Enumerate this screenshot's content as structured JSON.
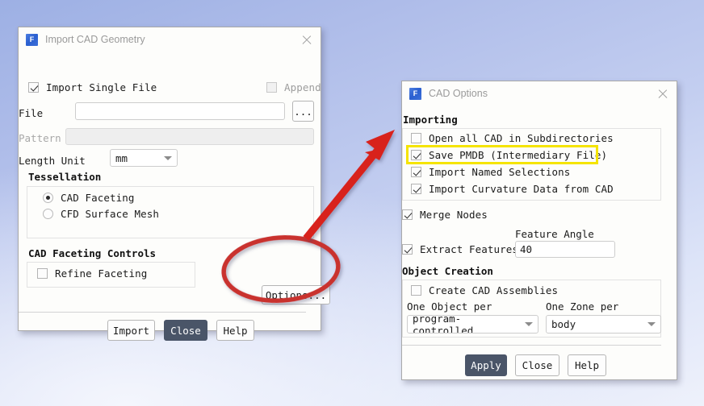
{
  "import_dialog": {
    "title": "Import CAD Geometry",
    "icon": "fluent-app-icon",
    "close_icon": "close-icon",
    "import_single_file": {
      "label": "Import Single File",
      "checked": true
    },
    "append": {
      "label": "Append",
      "checked": false,
      "enabled": false
    },
    "file": {
      "label": "File",
      "value": "",
      "browse_label": "..."
    },
    "pattern": {
      "label": "Pattern",
      "value": "",
      "enabled": false
    },
    "length_unit": {
      "label": "Length Unit",
      "value": "mm"
    },
    "tessellation": {
      "title": "Tessellation",
      "options": [
        {
          "label": "CAD Faceting",
          "selected": true
        },
        {
          "label": "CFD Surface Mesh",
          "selected": false
        }
      ]
    },
    "cad_faceting_controls": {
      "title": "CAD Faceting Controls",
      "refine_faceting": {
        "label": "Refine Faceting",
        "checked": false
      }
    },
    "options_button": "Options...",
    "buttons": [
      {
        "label": "Import",
        "primary": false
      },
      {
        "label": "Close",
        "primary": true
      },
      {
        "label": "Help",
        "primary": false
      }
    ]
  },
  "cad_options_dialog": {
    "title": "CAD Options",
    "icon": "fluent-app-icon",
    "close_icon": "close-icon",
    "importing": {
      "title": "Importing",
      "checkboxes": [
        {
          "label": "Open all CAD in Subdirectories",
          "checked": false,
          "highlighted": false
        },
        {
          "label": "Save PMDB (Intermediary File)",
          "checked": true,
          "highlighted": true
        },
        {
          "label": "Import Named Selections",
          "checked": true,
          "highlighted": false
        },
        {
          "label": "Import Curvature Data from CAD",
          "checked": true,
          "highlighted": false
        }
      ]
    },
    "merge_nodes": {
      "label": "Merge Nodes",
      "checked": true
    },
    "extract_features": {
      "label": "Extract Features",
      "checked": true
    },
    "feature_angle": {
      "label": "Feature Angle",
      "value": "40"
    },
    "object_creation": {
      "title": "Object Creation",
      "create_cad_assemblies": {
        "label": "Create CAD Assemblies",
        "checked": false
      },
      "one_object_per": {
        "label": "One Object per",
        "value": "program-controlled"
      },
      "one_zone_per": {
        "label": "One Zone per",
        "value": "body"
      }
    },
    "buttons": [
      {
        "label": "Apply",
        "primary": true
      },
      {
        "label": "Close",
        "primary": false
      },
      {
        "label": "Help",
        "primary": false
      }
    ]
  },
  "annotations": {
    "ellipse": {
      "target": "Options...",
      "color": "#c9332f"
    },
    "arrow": {
      "from": "Options... button",
      "to": "Save PMDB checkbox",
      "color": "#d8231f"
    },
    "highlight_box": {
      "target": "Save PMDB (Intermediary File)",
      "color": "#f5e400"
    }
  }
}
